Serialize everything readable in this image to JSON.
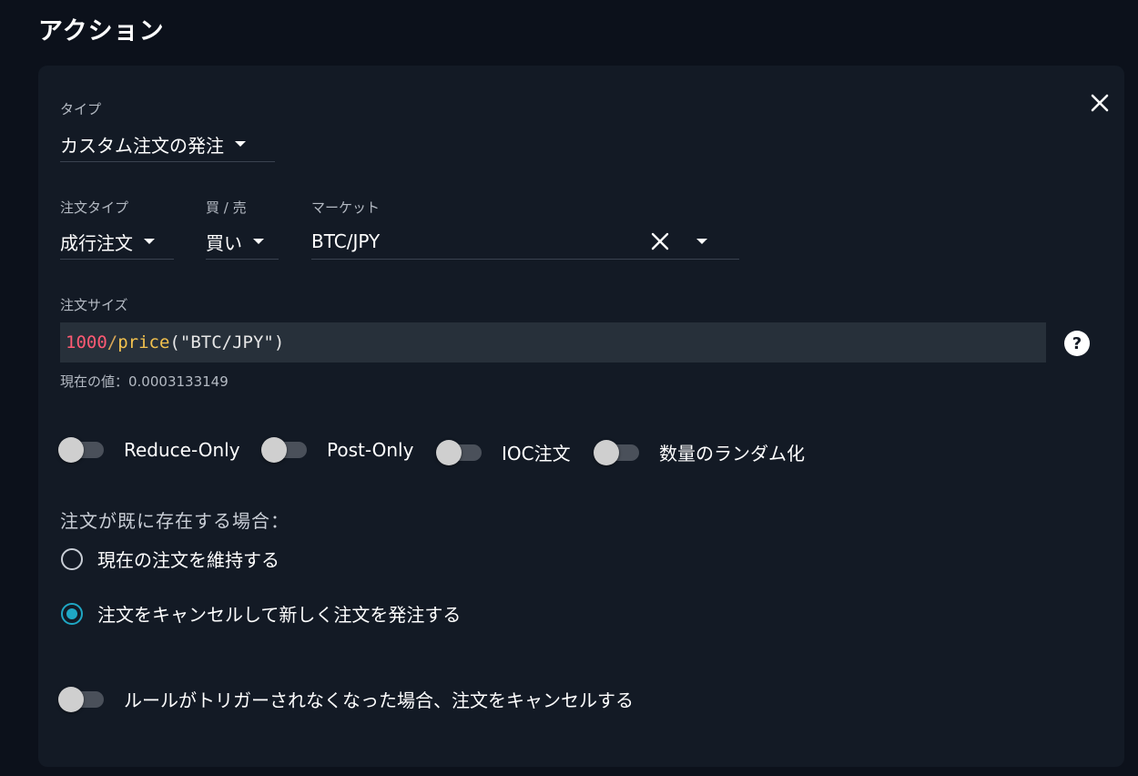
{
  "section": {
    "title": "アクション"
  },
  "card": {
    "type": {
      "label": "タイプ",
      "value": "カスタム注文の発注"
    },
    "order_type": {
      "label": "注文タイプ",
      "value": "成行注文"
    },
    "side": {
      "label": "買 / 売",
      "value": "買い"
    },
    "market": {
      "label": "マーケット",
      "value": "BTC/JPY"
    },
    "order_size": {
      "label": "注文サイズ",
      "formula_tokens": {
        "num": "1000",
        "op": "/",
        "fn": "price",
        "open": "(",
        "str": "\"BTC/JPY\"",
        "close": ")"
      },
      "current_value": "現在の値：0.0003133149"
    },
    "toggles": {
      "reduce_only": {
        "label": "Reduce-Only",
        "on": false
      },
      "post_only": {
        "label": "Post-Only",
        "on": false
      },
      "ioc": {
        "label": "IOC注文",
        "on": false
      },
      "randomize": {
        "label": "数量のランダム化",
        "on": false
      }
    },
    "existing_order": {
      "label": "注文が既に存在する場合：",
      "options": [
        {
          "label": "現在の注文を維持する",
          "selected": false
        },
        {
          "label": "注文をキャンセルして新しく注文を発注する",
          "selected": true
        }
      ]
    },
    "cancel_when_untriggered": {
      "label": "ルールがトリガーされなくなった場合、注文をキャンセルする",
      "on": false
    }
  },
  "colors": {
    "background": "#0c111b",
    "card": "#131a25",
    "accent": "#1fa7c4",
    "formula_bg": "#27303a"
  },
  "icons": {
    "close": "close-icon",
    "help": "help-icon",
    "dropdown": "caret-down-icon",
    "clear": "clear-icon"
  }
}
